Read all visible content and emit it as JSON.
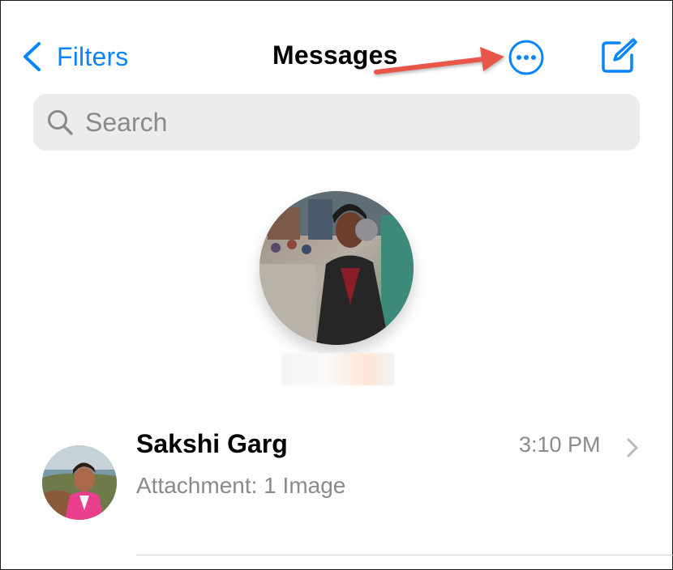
{
  "nav": {
    "back_label": "Filters",
    "title": "Messages",
    "accent": "#0a84ff",
    "icons": [
      "chevron-left-icon",
      "ellipsis-circle-icon",
      "compose-icon"
    ]
  },
  "annotation": {
    "arrow_color": "#e8574a"
  },
  "search": {
    "placeholder": "Search",
    "value": ""
  },
  "pinned": {
    "contact_name": ""
  },
  "conversations": [
    {
      "name": "Sakshi Garg",
      "time": "3:10 PM",
      "preview": "Attachment: 1 Image"
    }
  ]
}
